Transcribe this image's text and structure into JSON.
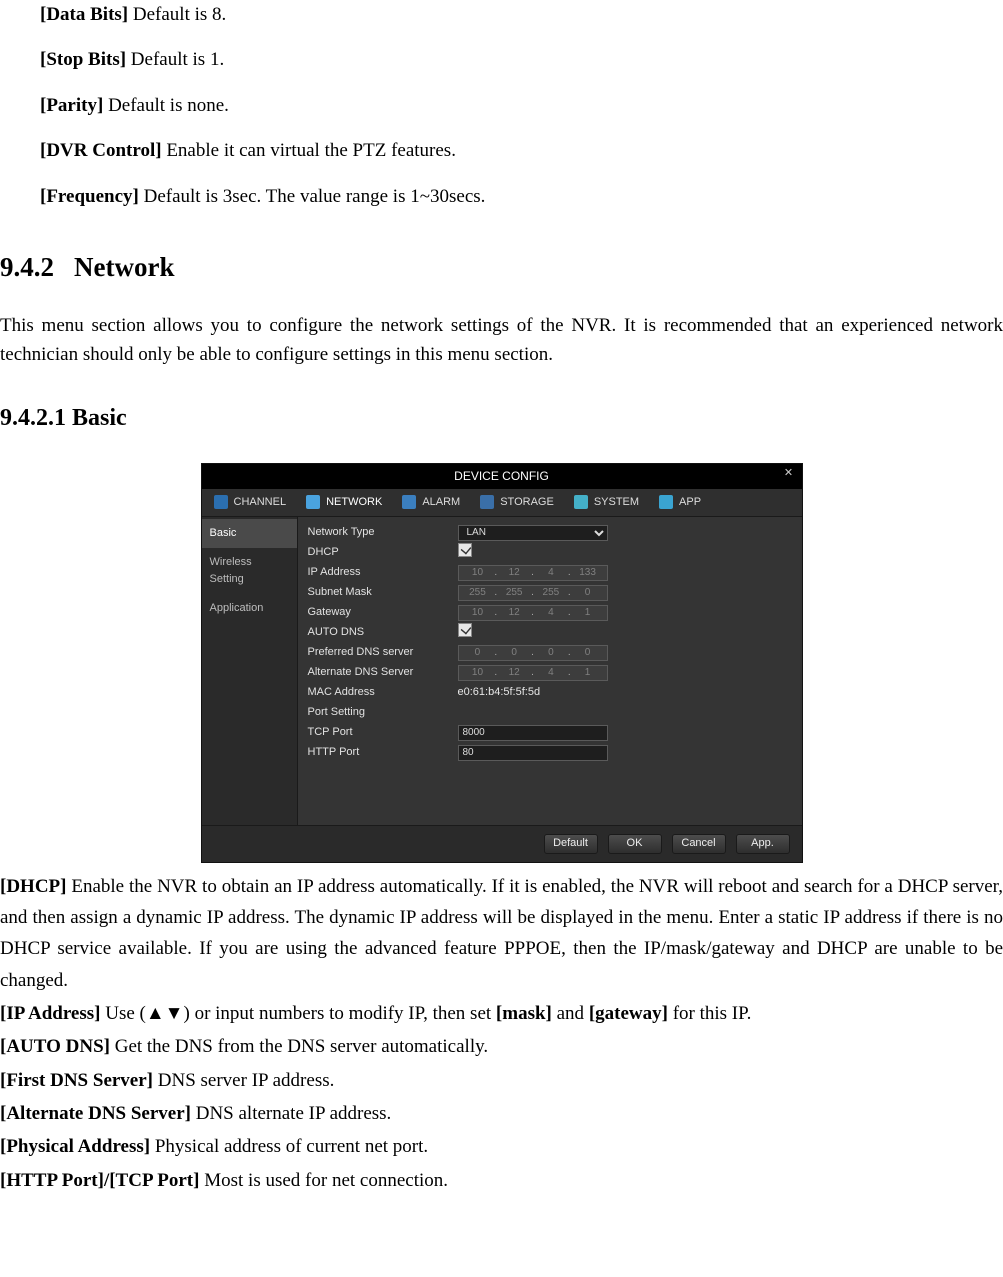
{
  "intro_items": [
    {
      "label": "[Data Bits]",
      "desc": " Default is 8."
    },
    {
      "label": "[Stop Bits]",
      "desc": " Default is 1."
    },
    {
      "label": "[Parity]",
      "desc": " Default is none."
    },
    {
      "label": "[DVR Control]",
      "desc": " Enable it can virtual the PTZ features."
    },
    {
      "label": "[Frequency]",
      "desc": " Default is 3sec. The value range is 1~30secs."
    }
  ],
  "section": {
    "number": "9.4.2",
    "title": "Network",
    "para": "This menu section allows you to configure the network settings of the NVR. It is recommended that an experienced network technician should only be able to configure settings in this menu section."
  },
  "subsection": {
    "title": "9.4.2.1 Basic"
  },
  "shot": {
    "window_title": "DEVICE CONFIG",
    "tabs": [
      "CHANNEL",
      "NETWORK",
      "ALARM",
      "STORAGE",
      "SYSTEM",
      "APP"
    ],
    "active_tab": 1,
    "sidebar": [
      "Basic",
      "Wireless Setting",
      "Application"
    ],
    "active_side": 0,
    "form": {
      "network_type_label": "Network Type",
      "network_type_value": "LAN",
      "dhcp_label": "DHCP",
      "dhcp_checked": true,
      "ip_label": "IP Address",
      "ip": [
        "10",
        "12",
        "4",
        "133"
      ],
      "mask_label": "Subnet Mask",
      "mask": [
        "255",
        "255",
        "255",
        "0"
      ],
      "gw_label": "Gateway",
      "gw": [
        "10",
        "12",
        "4",
        "1"
      ],
      "autodns_label": "AUTO DNS",
      "autodns_checked": true,
      "dns1_label": "Preferred DNS server",
      "dns1": [
        "0",
        "0",
        "0",
        "0"
      ],
      "dns2_label": "Alternate DNS Server",
      "dns2": [
        "10",
        "12",
        "4",
        "1"
      ],
      "mac_label": "MAC Address",
      "mac_value": "e0:61:b4:5f:5f:5d",
      "port_section": "Port Setting",
      "tcp_label": "TCP Port",
      "tcp_value": "8000",
      "http_label": "HTTP Port",
      "http_value": "80"
    },
    "buttons": [
      "Default",
      "OK",
      "Cancel",
      "App."
    ]
  },
  "defs": [
    {
      "label": "[DHCP]",
      "desc": " Enable the NVR to obtain an IP address automatically. If it is enabled, the NVR will reboot and search for a DHCP server, and then assign a dynamic IP address. The dynamic IP address will be displayed in the menu. Enter a static IP address if there is no DHCP service available. If you are using the advanced feature PPPOE, then the IP/mask/gateway and DHCP are unable to be changed."
    },
    {
      "label": "[IP Address]",
      "desc_pre": " Use (",
      "arrows": "▲▼",
      "desc_mid": ") or input numbers to modify IP, then set ",
      "b1": "[mask]",
      "and": " and ",
      "b2": "[gateway]",
      "desc_post": " for this IP."
    },
    {
      "label": "[AUTO DNS]",
      "desc": "   Get the DNS from the DNS server automatically."
    },
    {
      "label": "[First DNS Server]",
      "desc": " DNS server IP address."
    },
    {
      "label": "[Alternate DNS Server]",
      "desc": " DNS alternate IP address."
    },
    {
      "label": "[Physical Address]",
      "desc": " Physical address of current net port."
    },
    {
      "label": "[HTTP Port]/[TCP Port]",
      "desc": " Most is used for net connection."
    }
  ]
}
